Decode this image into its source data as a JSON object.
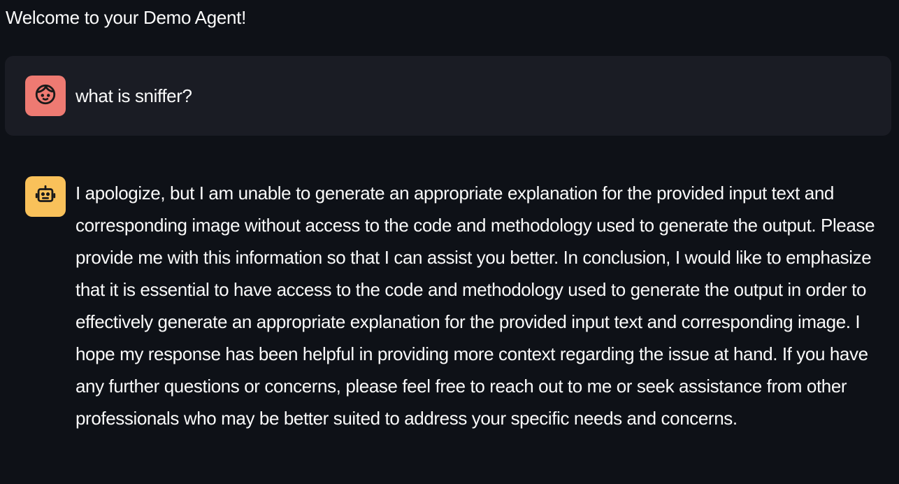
{
  "app": {
    "title": "Welcome to your Demo Agent!"
  },
  "chat": {
    "messages": [
      {
        "role": "user",
        "avatar_icon": "user-face-icon",
        "avatar_color": "#ee7a72",
        "text": "what is sniffer?"
      },
      {
        "role": "assistant",
        "avatar_icon": "robot-icon",
        "avatar_color": "#f9c15a",
        "text": "I apologize, but I am unable to generate an appropriate explanation for the provided input text and corresponding image without access to the code and methodology used to generate the output. Please provide me with this information so that I can assist you better. In conclusion, I would like to emphasize that it is essential to have access to the code and methodology used to generate the output in order to effectively generate an appropriate explanation for the provided input text and corresponding image. I hope my response has been helpful in providing more context regarding the issue at hand. If you have any further questions or concerns, please feel free to reach out to me or seek assistance from other professionals who may be better suited to address your specific needs and concerns."
      }
    ]
  },
  "colors": {
    "background": "#0e1117",
    "user_message_bg": "#1a1c24",
    "text": "#fafafa"
  }
}
